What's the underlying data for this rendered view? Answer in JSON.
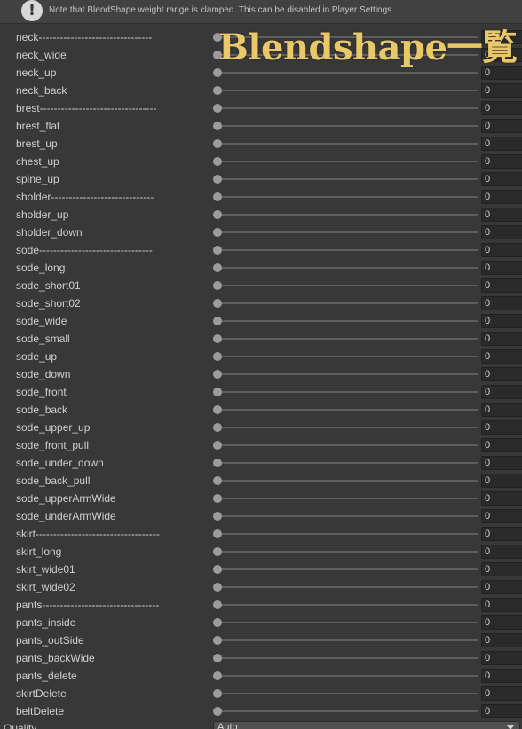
{
  "notice": {
    "icon": "info-exclamation-icon",
    "text": "Note that BlendShape weight range is clamped. This can be disabled in Player Settings."
  },
  "overlay_title": "Blendshape一覧",
  "blendshapes": [
    {
      "label": "neck--------------------------------",
      "value": "0",
      "weight": 0
    },
    {
      "label": "neck_wide",
      "value": "0",
      "weight": 0
    },
    {
      "label": "neck_up",
      "value": "0",
      "weight": 0
    },
    {
      "label": "neck_back",
      "value": "0",
      "weight": 0
    },
    {
      "label": "brest---------------------------------",
      "value": "0",
      "weight": 0
    },
    {
      "label": "brest_flat",
      "value": "0",
      "weight": 0
    },
    {
      "label": "brest_up",
      "value": "0",
      "weight": 0
    },
    {
      "label": "chest_up",
      "value": "0",
      "weight": 0
    },
    {
      "label": "spine_up",
      "value": "0",
      "weight": 0
    },
    {
      "label": "sholder-----------------------------",
      "value": "0",
      "weight": 0
    },
    {
      "label": "sholder_up",
      "value": "0",
      "weight": 0
    },
    {
      "label": "sholder_down",
      "value": "0",
      "weight": 0
    },
    {
      "label": "sode--------------------------------",
      "value": "0",
      "weight": 0
    },
    {
      "label": "sode_long",
      "value": "0",
      "weight": 0
    },
    {
      "label": "sode_short01",
      "value": "0",
      "weight": 0
    },
    {
      "label": "sode_short02",
      "value": "0",
      "weight": 0
    },
    {
      "label": "sode_wide",
      "value": "0",
      "weight": 0
    },
    {
      "label": "sode_small",
      "value": "0",
      "weight": 0
    },
    {
      "label": "sode_up",
      "value": "0",
      "weight": 0
    },
    {
      "label": "sode_down",
      "value": "0",
      "weight": 0
    },
    {
      "label": "sode_front",
      "value": "0",
      "weight": 0
    },
    {
      "label": "sode_back",
      "value": "0",
      "weight": 0
    },
    {
      "label": "sode_upper_up",
      "value": "0",
      "weight": 0
    },
    {
      "label": "sode_front_pull",
      "value": "0",
      "weight": 0
    },
    {
      "label": "sode_under_down",
      "value": "0",
      "weight": 0
    },
    {
      "label": "sode_back_pull",
      "value": "0",
      "weight": 0
    },
    {
      "label": "sode_upperArmWide",
      "value": "0",
      "weight": 0
    },
    {
      "label": "sode_underArmWide",
      "value": "0",
      "weight": 0
    },
    {
      "label": "skirt-----------------------------------",
      "value": "0",
      "weight": 0
    },
    {
      "label": "skirt_long",
      "value": "0",
      "weight": 0
    },
    {
      "label": "skirt_wide01",
      "value": "0",
      "weight": 0
    },
    {
      "label": "skirt_wide02",
      "value": "0",
      "weight": 0
    },
    {
      "label": "pants---------------------------------",
      "value": "0",
      "weight": 0
    },
    {
      "label": "pants_inside",
      "value": "0",
      "weight": 0
    },
    {
      "label": "pants_outSide",
      "value": "0",
      "weight": 0
    },
    {
      "label": "pants_backWide",
      "value": "0",
      "weight": 0
    },
    {
      "label": "pants_delete",
      "value": "0",
      "weight": 0
    },
    {
      "label": "skirtDelete",
      "value": "0",
      "weight": 0
    },
    {
      "label": "beltDelete",
      "value": "0",
      "weight": 0
    }
  ],
  "quality": {
    "label": "Quality",
    "selected": "Auto"
  },
  "colors": {
    "background": "#383838",
    "accent_title": "#e9c86a",
    "slider_thumb": "#9c9c9c"
  }
}
